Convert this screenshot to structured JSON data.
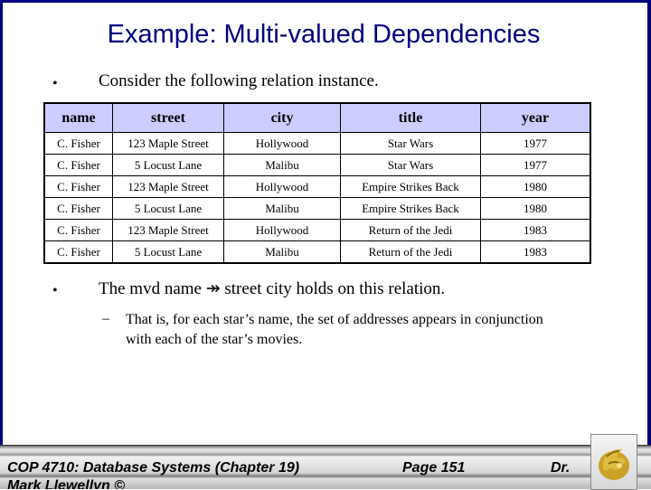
{
  "slide": {
    "title": "Example: Multi-valued Dependencies",
    "bullet1": {
      "marker": "•",
      "text": "Consider the following relation instance."
    },
    "table": {
      "headers": [
        "name",
        "street",
        "city",
        "title",
        "year"
      ],
      "rows": [
        [
          "C. Fisher",
          "123 Maple Street",
          "Hollywood",
          "Star Wars",
          "1977"
        ],
        [
          "C. Fisher",
          "5 Locust Lane",
          "Malibu",
          "Star Wars",
          "1977"
        ],
        [
          "C. Fisher",
          "123 Maple Street",
          "Hollywood",
          "Empire Strikes Back",
          "1980"
        ],
        [
          "C. Fisher",
          "5 Locust Lane",
          "Malibu",
          "Empire Strikes Back",
          "1980"
        ],
        [
          "C. Fisher",
          "123 Maple Street",
          "Hollywood",
          "Return of the Jedi",
          "1983"
        ],
        [
          "C. Fisher",
          "5 Locust Lane",
          "Malibu",
          "Return of the Jedi",
          "1983"
        ]
      ]
    },
    "bullet2": {
      "marker": "•",
      "text": "The mvd   name ↠ street city holds on this relation."
    },
    "sub_bullet": {
      "marker": "–",
      "line1": "That is, for each star’s name, the set of addresses appears in conjunction",
      "line2": "with each of the star’s movies."
    }
  },
  "footer": {
    "course": "COP 4710: Database Systems  (Chapter 19)",
    "page": "Page 151",
    "author_part1": "Dr.",
    "author_part2": "Mark Llewellyn ©"
  },
  "colors": {
    "title": "#000080",
    "frame": "#000080",
    "table_header_bg": "#ccccff",
    "logo_gold": "#c9a227"
  }
}
